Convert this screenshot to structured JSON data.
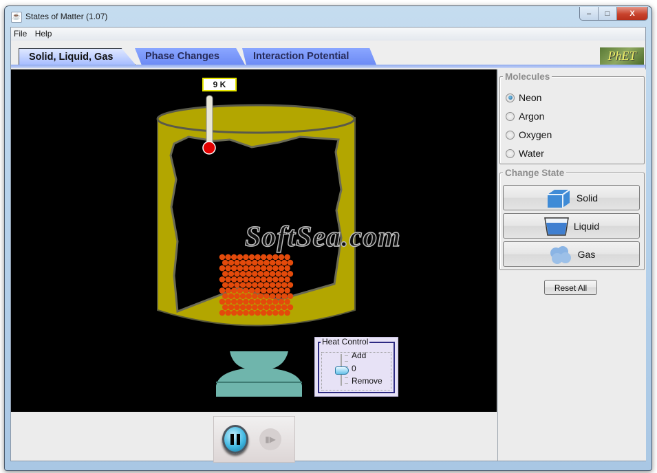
{
  "window": {
    "title": "States of Matter (1.07)",
    "app_icon": "java-icon",
    "controls": {
      "minimize": "–",
      "maximize": "□",
      "close": "X"
    }
  },
  "menu": {
    "items": [
      "File",
      "Help"
    ]
  },
  "tabs": [
    {
      "label": "Solid, Liquid, Gas",
      "active": true
    },
    {
      "label": "Phase Changes",
      "active": false
    },
    {
      "label": "Interaction Potential",
      "active": false
    }
  ],
  "logo": {
    "text": "PhET"
  },
  "simulation": {
    "thermometer_reading": "9 K",
    "container_color": "#b6a800",
    "particle_color": "#e34a0b",
    "particle_grid": {
      "rows": 11,
      "cols": 12
    },
    "heat_control": {
      "title": "Heat Control",
      "add_label": "Add",
      "zero_label": "0",
      "remove_label": "Remove",
      "value": 0
    },
    "watermark": "SoftSea.com"
  },
  "clock_controls": {
    "pause_label": "Pause",
    "step_label": "Step"
  },
  "side_panel": {
    "molecules": {
      "title": "Molecules",
      "options": [
        {
          "label": "Neon",
          "selected": true
        },
        {
          "label": "Argon",
          "selected": false
        },
        {
          "label": "Oxygen",
          "selected": false
        },
        {
          "label": "Water",
          "selected": false
        }
      ]
    },
    "change_state": {
      "title": "Change State",
      "buttons": [
        {
          "label": "Solid",
          "icon": "ice-cube-icon"
        },
        {
          "label": "Liquid",
          "icon": "water-cup-icon"
        },
        {
          "label": "Gas",
          "icon": "gas-cloud-icon"
        }
      ]
    },
    "reset_label": "Reset All"
  }
}
